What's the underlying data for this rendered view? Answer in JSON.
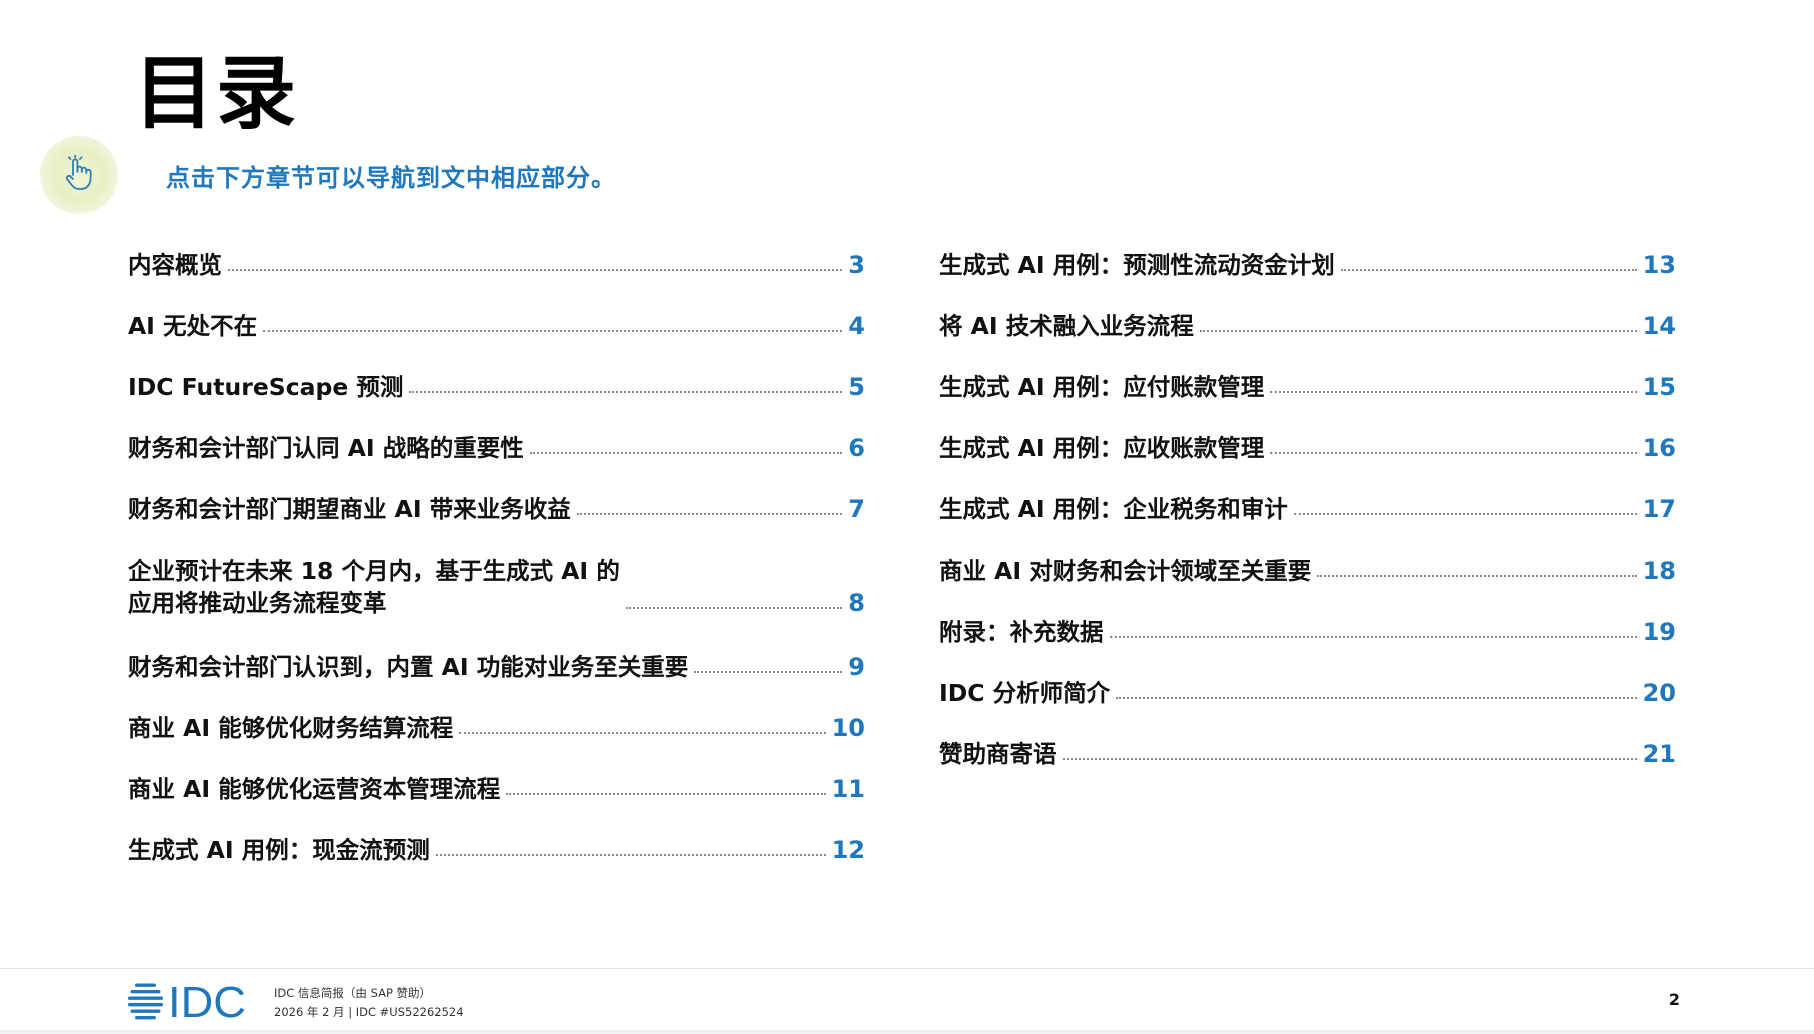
{
  "page": {
    "title": "目录",
    "hint": "点击下方章节可以导航到文中相应部分。"
  },
  "toc": {
    "left": [
      {
        "label": "内容概览",
        "page": "3"
      },
      {
        "label": "AI 无处不在",
        "page": "4"
      },
      {
        "label": "IDC FutureScape 预测",
        "page": "5"
      },
      {
        "label": "财务和会计部门认同 AI 战略的重要性",
        "page": "6"
      },
      {
        "label": "财务和会计部门期望商业 AI 带来业务收益",
        "page": "7"
      },
      {
        "label": "企业预计在未来 18 个月内，基于生成式 AI 的\n应用将推动业务流程变革",
        "page": "8"
      },
      {
        "label": "财务和会计部门认识到，内置 AI 功能对业务至关重要",
        "page": "9"
      },
      {
        "label": "商业 AI 能够优化财务结算流程",
        "page": "10"
      },
      {
        "label": "商业 AI 能够优化运营资本管理流程",
        "page": "11"
      },
      {
        "label": "生成式 AI 用例：现金流预测",
        "page": "12"
      }
    ],
    "right": [
      {
        "label": "生成式 AI 用例：预测性流动资金计划",
        "page": "13"
      },
      {
        "label": "将 AI 技术融入业务流程",
        "page": "14"
      },
      {
        "label": "生成式 AI 用例：应付账款管理",
        "page": "15"
      },
      {
        "label": "生成式 AI 用例：应收账款管理",
        "page": "16"
      },
      {
        "label": "生成式 AI 用例：企业税务和审计",
        "page": "17"
      },
      {
        "label": "商业 AI 对财务和会计领域至关重要",
        "page": "18"
      },
      {
        "label": "附录：补充数据",
        "page": "19"
      },
      {
        "label": "IDC 分析师简介",
        "page": "20"
      },
      {
        "label": "赞助商寄语",
        "page": "21"
      }
    ]
  },
  "footer": {
    "logo_text": "IDC",
    "line1": "IDC 信息简报（由 SAP 赞助）",
    "line2": "2026 年 2 月 | IDC #US52262524",
    "page_number": "2"
  },
  "icons": {
    "hint_icon": "pointing-hand-icon",
    "logo_icon": "idc-globe-icon"
  },
  "colors": {
    "accent": "#1f78bd",
    "logo": "#1f78bd",
    "hint_circle": "#e7f0c4",
    "title": "#000000",
    "text": "#111111"
  }
}
